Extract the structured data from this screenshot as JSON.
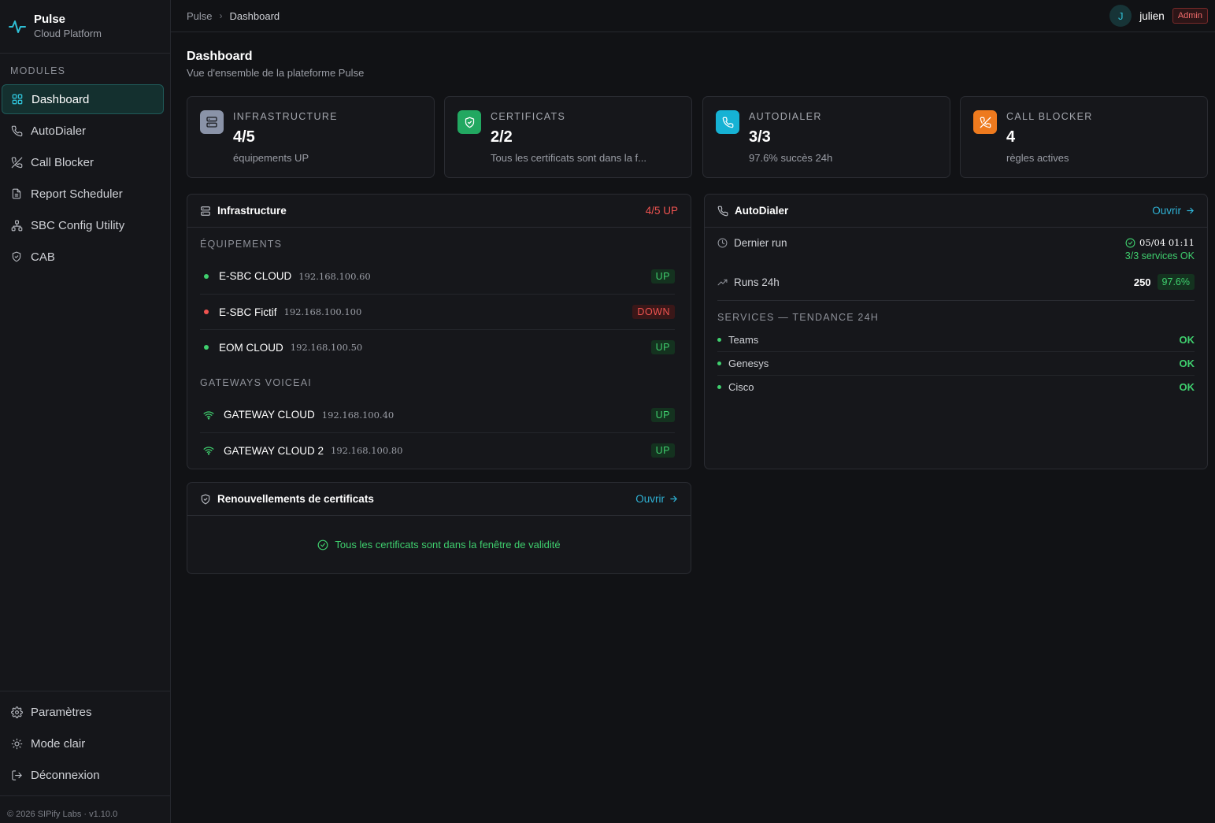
{
  "brand": {
    "name": "Pulse",
    "subtitle": "Cloud Platform"
  },
  "sidebar": {
    "section_title": "MODULES",
    "items": [
      {
        "label": "Dashboard",
        "icon": "grid-icon",
        "active": true
      },
      {
        "label": "AutoDialer",
        "icon": "phone-icon"
      },
      {
        "label": "Call Blocker",
        "icon": "phone-off-icon"
      },
      {
        "label": "Report Scheduler",
        "icon": "file-icon"
      },
      {
        "label": "SBC Config Utility",
        "icon": "network-icon"
      },
      {
        "label": "CAB",
        "icon": "shield-icon"
      }
    ],
    "bottom_items": [
      {
        "label": "Paramètres",
        "icon": "gear-icon"
      },
      {
        "label": "Mode clair",
        "icon": "sun-icon"
      },
      {
        "label": "Déconnexion",
        "icon": "logout-icon"
      }
    ],
    "copyright": "© 2026 SIPify Labs · v1.10.0"
  },
  "topbar": {
    "breadcrumb": [
      "Pulse",
      "Dashboard"
    ],
    "user": {
      "initial": "J",
      "name": "julien",
      "role": "Admin"
    }
  },
  "page": {
    "title": "Dashboard",
    "subtitle": "Vue d'ensemble de la plateforme Pulse"
  },
  "stats": [
    {
      "label": "INFRASTRUCTURE",
      "value": "4/5",
      "desc": "équipements UP",
      "color": "#8a93a8",
      "icon": "server-icon"
    },
    {
      "label": "CERTIFICATS",
      "value": "2/2",
      "desc": "Tous les certificats sont dans la f...",
      "color": "#22a861",
      "icon": "shield-check-icon"
    },
    {
      "label": "AUTODIALER",
      "value": "3/3",
      "desc": "97.6% succès 24h",
      "color": "#16b2d4",
      "icon": "phone-icon"
    },
    {
      "label": "CALL BLOCKER",
      "value": "4",
      "desc": "règles actives",
      "color": "#ee7a1e",
      "icon": "phone-off-icon"
    }
  ],
  "infrastructure": {
    "title": "Infrastructure",
    "summary": "4/5 UP",
    "groups": [
      {
        "title": "ÉQUIPEMENTS",
        "devices": [
          {
            "name": "E-SBC CLOUD",
            "ip": "192.168.100.60",
            "status": "UP"
          },
          {
            "name": "E-SBC Fictif",
            "ip": "192.168.100.100",
            "status": "DOWN"
          },
          {
            "name": "EOM CLOUD",
            "ip": "192.168.100.50",
            "status": "UP"
          }
        ]
      },
      {
        "title": "GATEWAYS VOICEAI",
        "devices": [
          {
            "name": "GATEWAY CLOUD",
            "ip": "192.168.100.40",
            "status": "UP"
          },
          {
            "name": "GATEWAY CLOUD 2",
            "ip": "192.168.100.80",
            "status": "UP"
          }
        ]
      }
    ]
  },
  "certificates": {
    "title": "Renouvellements de certificats",
    "open_label": "Ouvrir",
    "message": "Tous les certificats sont dans la fenêtre de validité"
  },
  "autodialer": {
    "title": "AutoDialer",
    "open_label": "Ouvrir",
    "last_run_label": "Dernier run",
    "last_run_value": "05/04 01:11",
    "services_ok": "3/3 services OK",
    "runs_label": "Runs 24h",
    "runs_value": "250",
    "success_rate": "97.6%",
    "services_title": "SERVICES — TENDANCE 24H",
    "services": [
      {
        "name": "Teams",
        "status": "OK"
      },
      {
        "name": "Genesys",
        "status": "OK"
      },
      {
        "name": "Cisco",
        "status": "OK"
      }
    ]
  }
}
